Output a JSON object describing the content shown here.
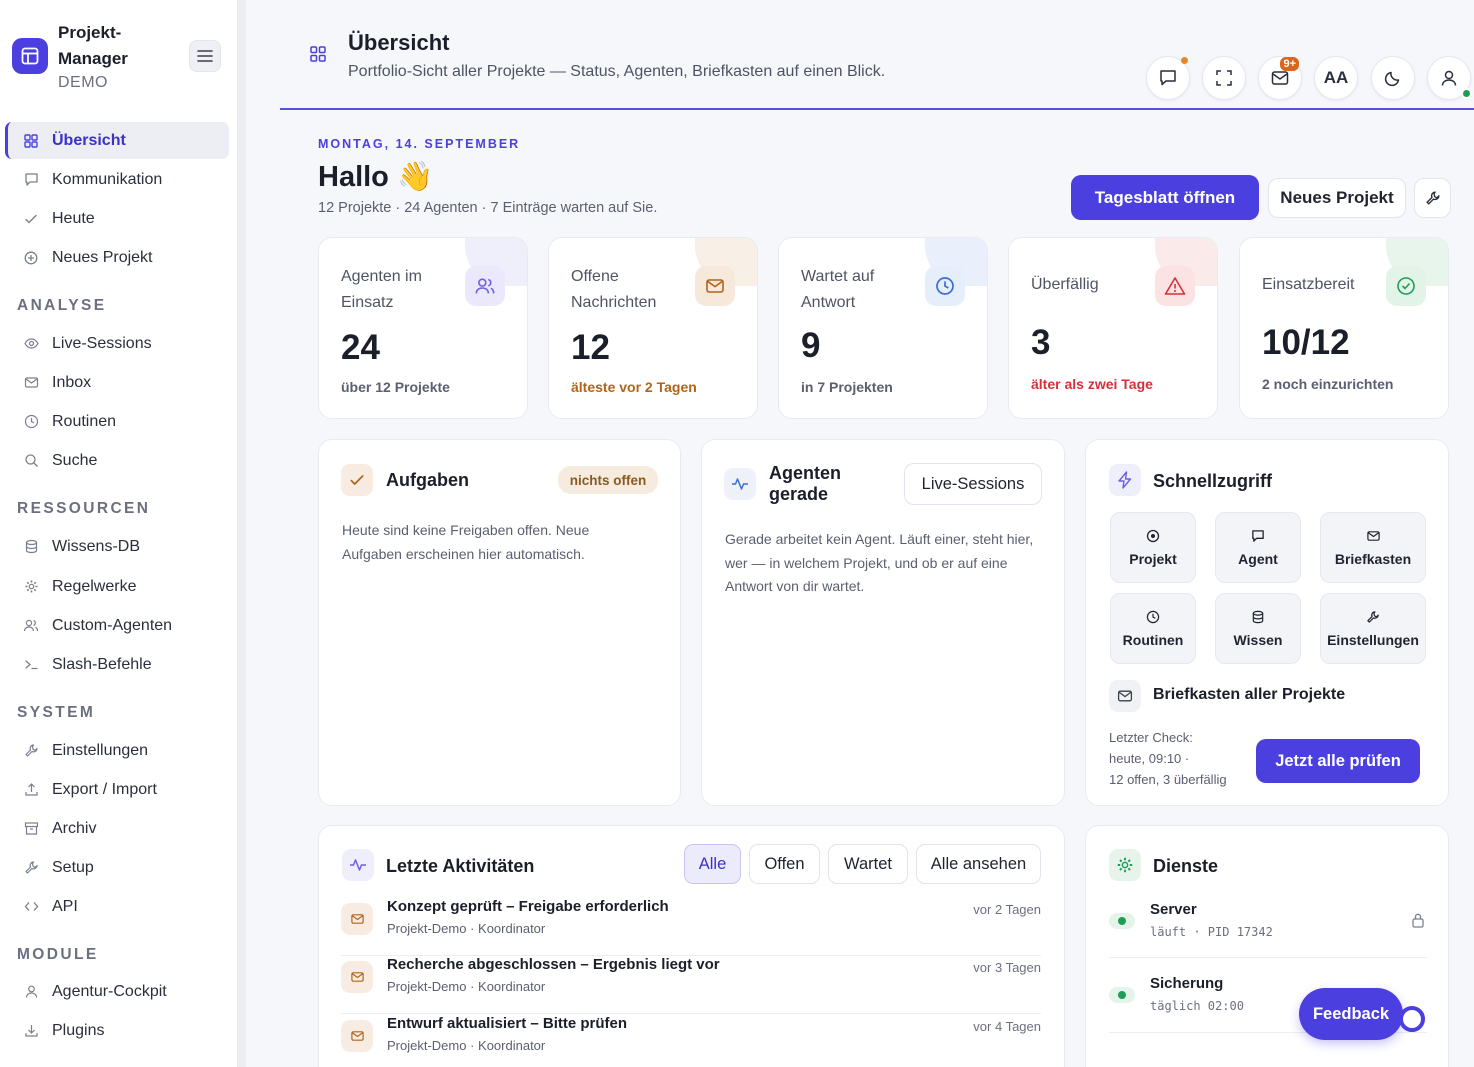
{
  "brand": {
    "name_line1": "Projekt-",
    "name_line2": "Manager",
    "sub": "DEMO"
  },
  "nav": {
    "main": [
      {
        "label": "Übersicht",
        "icon": "grid-icon"
      },
      {
        "label": "Kommunikation",
        "icon": "chat-icon"
      },
      {
        "label": "Heute",
        "icon": "check-icon"
      },
      {
        "label": "Neues Projekt",
        "icon": "plus-circle-icon"
      }
    ],
    "sections": [
      {
        "title": "ANALYSE",
        "items": [
          {
            "label": "Live-Sessions",
            "icon": "eye-icon"
          },
          {
            "label": "Inbox",
            "icon": "mail-icon"
          },
          {
            "label": "Routinen",
            "icon": "clock-icon"
          },
          {
            "label": "Suche",
            "icon": "search-icon"
          }
        ]
      },
      {
        "title": "RESSOURCEN",
        "items": [
          {
            "label": "Wissens-DB",
            "icon": "database-icon"
          },
          {
            "label": "Regelwerke",
            "icon": "gear-icon"
          },
          {
            "label": "Custom-Agenten",
            "icon": "users-icon"
          },
          {
            "label": "Slash-Befehle",
            "icon": "terminal-icon"
          }
        ]
      },
      {
        "title": "SYSTEM",
        "items": [
          {
            "label": "Einstellungen",
            "icon": "wrench-icon"
          },
          {
            "label": "Export / Import",
            "icon": "upload-icon"
          },
          {
            "label": "Archiv",
            "icon": "archive-icon"
          },
          {
            "label": "Setup",
            "icon": "wrench-icon"
          },
          {
            "label": "API",
            "icon": "code-icon"
          }
        ]
      },
      {
        "title": "MODULE",
        "items": [
          {
            "label": "Agentur-Cockpit",
            "icon": "user-icon"
          },
          {
            "label": "Plugins",
            "icon": "download-icon"
          }
        ]
      }
    ]
  },
  "header": {
    "title": "Übersicht",
    "subtitle": "Portfolio-Sicht aller Projekte — Status, Agenten, Briefkasten auf einen Blick.",
    "inbox_badge": "9+",
    "font_button": "AA"
  },
  "greeting": {
    "date": "MONTAG, 14. SEPTEMBER",
    "hello": "Hallo 👋",
    "summary": "12 Projekte · 24 Agenten · 7 Einträge warten auf Sie.",
    "primary_button": "Tagesblatt öffnen",
    "secondary_button": "Neues Projekt"
  },
  "stats": [
    {
      "label": "Agenten im Einsatz",
      "value": "24",
      "note": "über 12 Projekte",
      "accent": "#6d5fe6"
    },
    {
      "label": "Offene Nachrichten",
      "value": "12",
      "note": "älteste vor 2 Tagen",
      "accent": "#b0651b"
    },
    {
      "label": "Wartet auf Antwort",
      "value": "9",
      "note": "in 7 Projekten",
      "accent": "#3b6fd6"
    },
    {
      "label": "Überfällig",
      "value": "3",
      "note": "älter als zwei Tage",
      "accent": "#d62f3a"
    },
    {
      "label": "Einsatzbereit",
      "value": "10/12",
      "note": "2 noch einzurichten",
      "accent": "#1f9d55"
    }
  ],
  "tasks": {
    "title": "Aufgaben",
    "badge": "nichts offen",
    "text": "Heute sind keine Freigaben offen. Neue Aufgaben erscheinen hier automatisch."
  },
  "agents": {
    "title_line1": "Agenten",
    "title_line2": "gerade",
    "button": "Live-Sessions",
    "text": "Gerade arbeitet kein Agent. Läuft einer, steht hier, wer — in welchem Projekt, und ob er auf eine Antwort von dir wartet."
  },
  "quick": {
    "title": "Schnellzugriff",
    "tiles": [
      {
        "label": "Projekt",
        "icon": "target-icon"
      },
      {
        "label": "Agent",
        "icon": "chat-icon"
      },
      {
        "label": "Briefkasten",
        "icon": "mail-icon"
      },
      {
        "label": "Routinen",
        "icon": "clock-icon"
      },
      {
        "label": "Wissen",
        "icon": "database-icon"
      },
      {
        "label": "Einstellungen",
        "icon": "wrench-icon"
      }
    ],
    "mailbox_title": "Briefkasten aller Projekte",
    "check_line1": "Letzter Check:",
    "check_line2": "heute, 09:10 ·",
    "check_line3": "12 offen, 3 überfällig",
    "check_button": "Jetzt alle prüfen"
  },
  "activity": {
    "title": "Letzte Aktivitäten",
    "filters": [
      "Alle",
      "Offen",
      "Wartet",
      "Alle ansehen"
    ],
    "rows": [
      {
        "title": "Konzept geprüft – Freigabe erforderlich",
        "project": "Projekt-Demo",
        "role": "Koordinator",
        "time": "vor 2 Tagen"
      },
      {
        "title": "Recherche abgeschlossen – Ergebnis liegt vor",
        "project": "Projekt-Demo",
        "role": "Koordinator",
        "time": "vor 3 Tagen"
      },
      {
        "title": "Entwurf aktualisiert – Bitte prüfen",
        "project": "Projekt-Demo",
        "role": "Koordinator",
        "time": "vor 4 Tagen"
      }
    ]
  },
  "services": {
    "title": "Dienste",
    "items": [
      {
        "name": "Server",
        "detail": "läuft · PID 17342"
      },
      {
        "name": "Sicherung",
        "detail": "täglich 02:00"
      }
    ]
  },
  "feedback": "Feedback",
  "colors": {
    "accent": "#4b3fe0",
    "success": "#1f9d55",
    "danger": "#d62f3a",
    "warning": "#b0651b"
  }
}
